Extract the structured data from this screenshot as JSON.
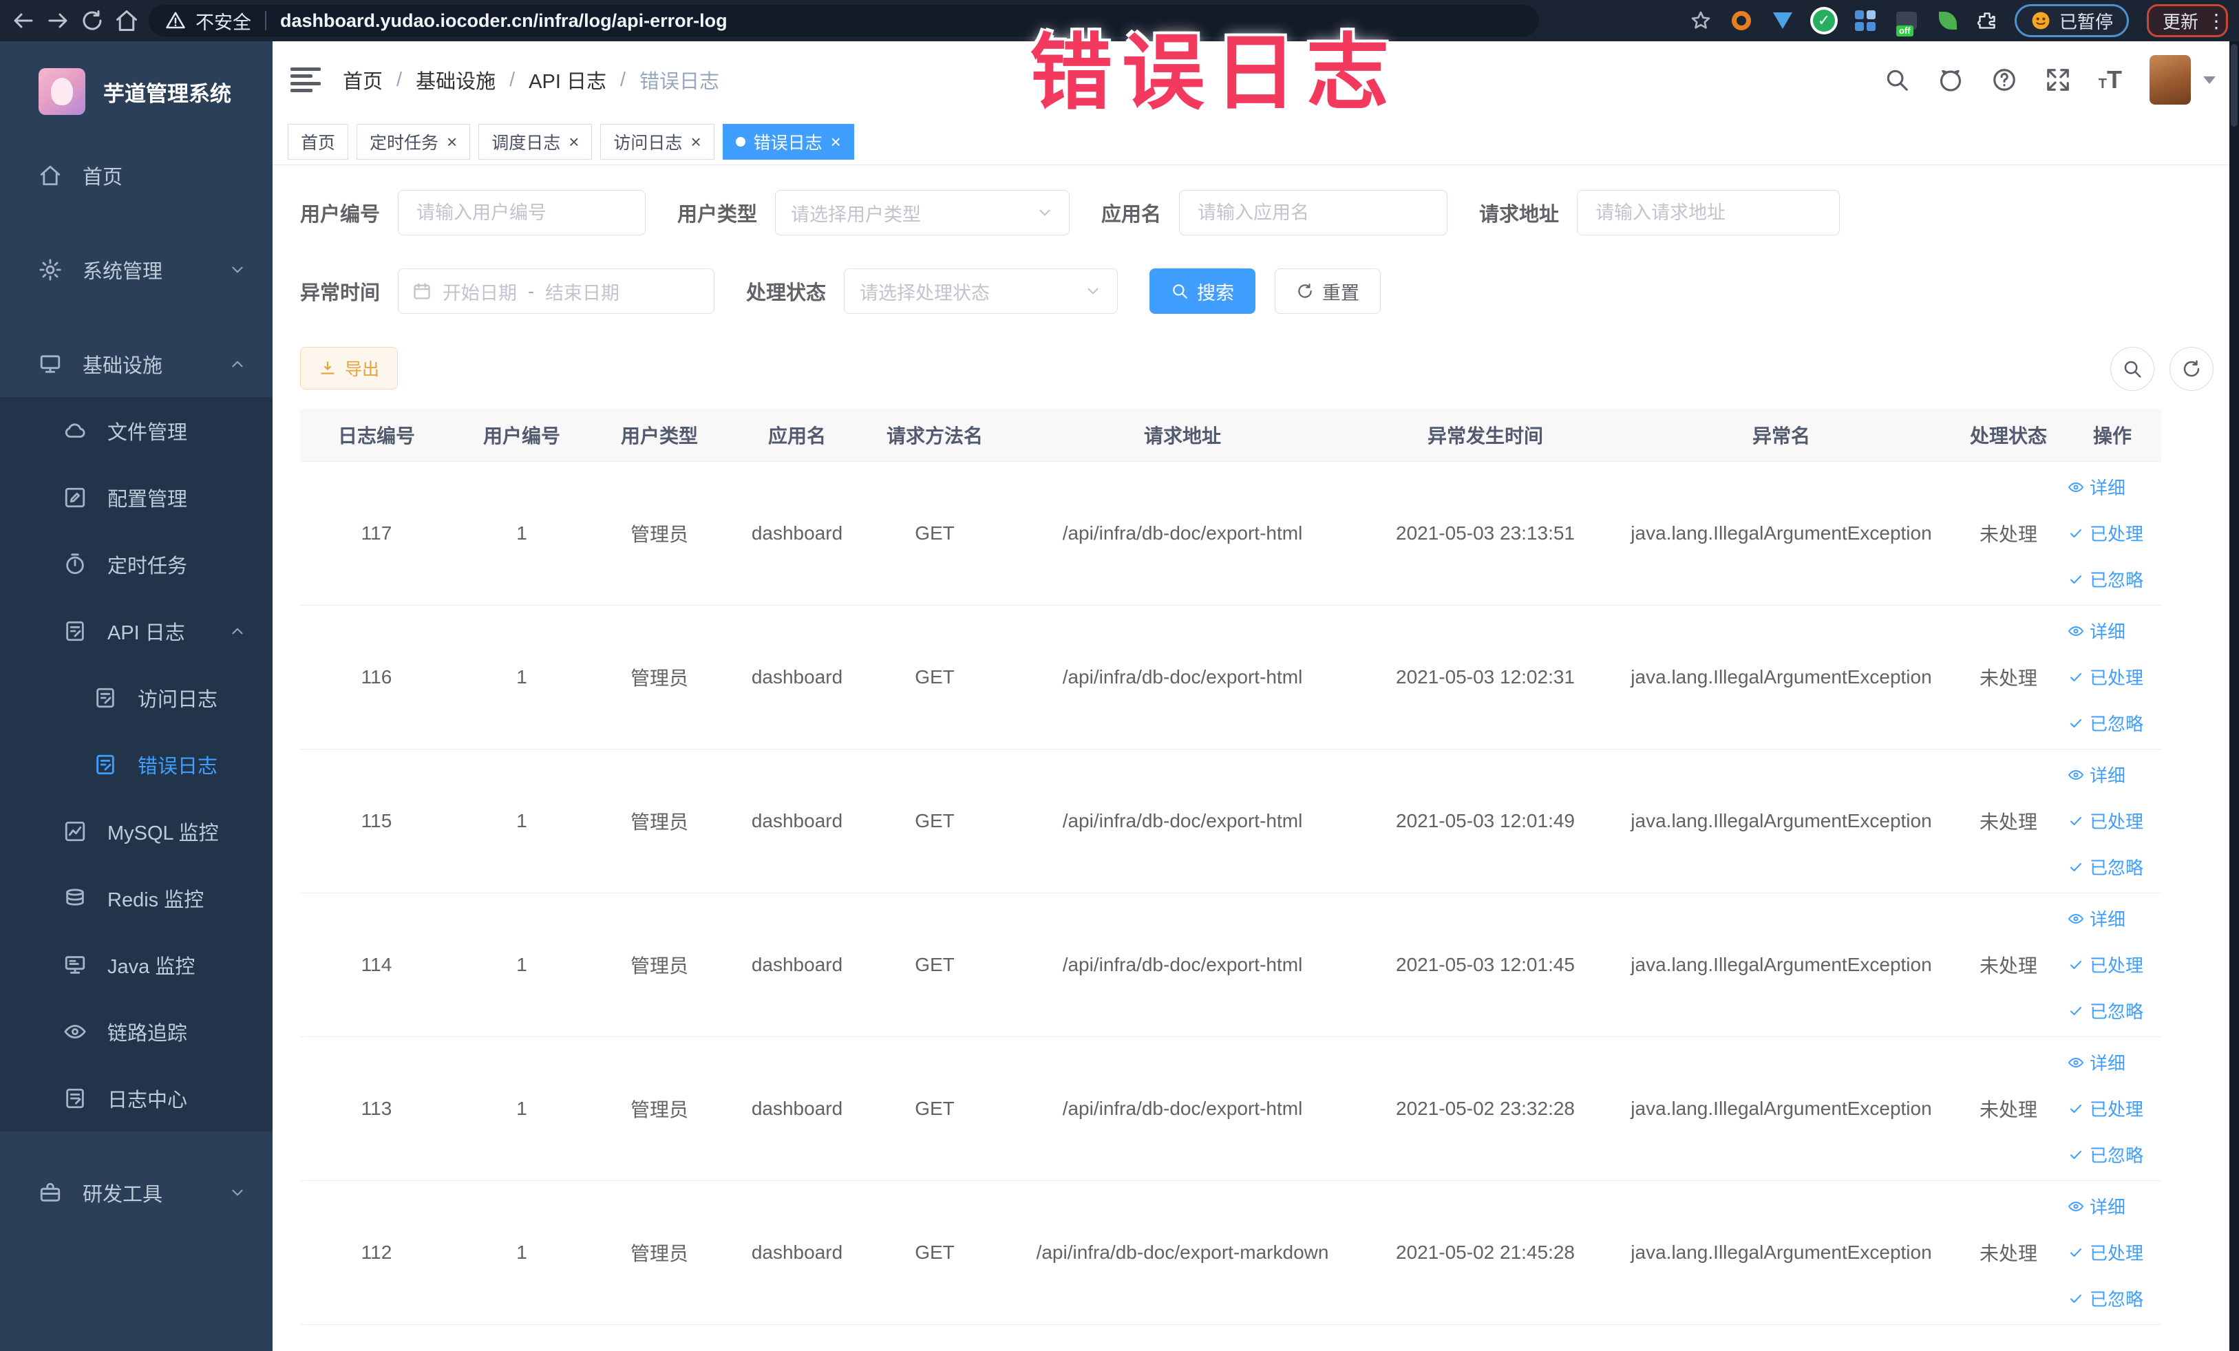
{
  "overlay_title": "错误日志",
  "browser": {
    "security_label": "不安全",
    "url": "dashboard.yudao.iocoder.cn/infra/log/api-error-log",
    "paused_badge": "已暂停",
    "update_badge": "更新"
  },
  "sidebar": {
    "logo_title": "芋道管理系统",
    "items": [
      {
        "label": "首页",
        "icon": "home",
        "depth": 0,
        "chevron": null,
        "active": false,
        "sub": false
      },
      {
        "label": "系统管理",
        "icon": "gear",
        "depth": 0,
        "chevron": "down",
        "active": false,
        "sub": false,
        "gap": true
      },
      {
        "label": "基础设施",
        "icon": "monitor",
        "depth": 0,
        "chevron": "up",
        "active": false,
        "sub": false,
        "gap": true
      },
      {
        "label": "文件管理",
        "icon": "cloud",
        "depth": 1,
        "chevron": null,
        "active": false,
        "sub": true
      },
      {
        "label": "配置管理",
        "icon": "edit",
        "depth": 1,
        "chevron": null,
        "active": false,
        "sub": true
      },
      {
        "label": "定时任务",
        "icon": "timer",
        "depth": 1,
        "chevron": null,
        "active": false,
        "sub": true
      },
      {
        "label": "API 日志",
        "icon": "apilog",
        "depth": 1,
        "chevron": "up",
        "active": false,
        "sub": true
      },
      {
        "label": "访问日志",
        "icon": "apilog",
        "depth": 2,
        "chevron": null,
        "active": false,
        "sub": true
      },
      {
        "label": "错误日志",
        "icon": "apilog",
        "depth": 2,
        "chevron": null,
        "active": true,
        "sub": true
      },
      {
        "label": "MySQL 监控",
        "icon": "mysql",
        "depth": 1,
        "chevron": null,
        "active": false,
        "sub": true
      },
      {
        "label": "Redis 监控",
        "icon": "redis",
        "depth": 1,
        "chevron": null,
        "active": false,
        "sub": true
      },
      {
        "label": "Java 监控",
        "icon": "java",
        "depth": 1,
        "chevron": null,
        "active": false,
        "sub": true
      },
      {
        "label": "链路追踪",
        "icon": "trace",
        "depth": 1,
        "chevron": null,
        "active": false,
        "sub": true
      },
      {
        "label": "日志中心",
        "icon": "logcenter",
        "depth": 1,
        "chevron": null,
        "active": false,
        "sub": true
      },
      {
        "label": "研发工具",
        "icon": "tools",
        "depth": 0,
        "chevron": "down",
        "active": false,
        "sub": false,
        "gap": true
      }
    ]
  },
  "header": {
    "breadcrumb": [
      "首页",
      "基础设施",
      "API 日志",
      "错误日志"
    ]
  },
  "tabs": [
    {
      "label": "首页",
      "closable": false,
      "active": false
    },
    {
      "label": "定时任务",
      "closable": true,
      "active": false
    },
    {
      "label": "调度日志",
      "closable": true,
      "active": false
    },
    {
      "label": "访问日志",
      "closable": true,
      "active": false
    },
    {
      "label": "错误日志",
      "closable": true,
      "active": true
    }
  ],
  "filters": {
    "user_id": {
      "label": "用户编号",
      "placeholder": "请输入用户编号"
    },
    "user_type": {
      "label": "用户类型",
      "placeholder": "请选择用户类型"
    },
    "app_name": {
      "label": "应用名",
      "placeholder": "请输入应用名"
    },
    "request_url": {
      "label": "请求地址",
      "placeholder": "请输入请求地址"
    },
    "exception_time": {
      "label": "异常时间",
      "start_placeholder": "开始日期",
      "separator": "-",
      "end_placeholder": "结束日期"
    },
    "process_status": {
      "label": "处理状态",
      "placeholder": "请选择处理状态"
    },
    "search_label": "搜索",
    "reset_label": "重置"
  },
  "toolbar": {
    "export_label": "导出"
  },
  "table": {
    "columns": [
      "日志编号",
      "用户编号",
      "用户类型",
      "应用名",
      "请求方法名",
      "请求地址",
      "异常发生时间",
      "异常名",
      "处理状态",
      "操作"
    ],
    "rows": [
      {
        "cells": [
          "117",
          "1",
          "管理员",
          "dashboard",
          "GET",
          "/api/infra/db-doc/export-html",
          "2021-05-03 23:13:51",
          "java.lang.IllegalArgumentException",
          "未处理"
        ]
      },
      {
        "cells": [
          "116",
          "1",
          "管理员",
          "dashboard",
          "GET",
          "/api/infra/db-doc/export-html",
          "2021-05-03 12:02:31",
          "java.lang.IllegalArgumentException",
          "未处理"
        ]
      },
      {
        "cells": [
          "115",
          "1",
          "管理员",
          "dashboard",
          "GET",
          "/api/infra/db-doc/export-html",
          "2021-05-03 12:01:49",
          "java.lang.IllegalArgumentException",
          "未处理"
        ]
      },
      {
        "cells": [
          "114",
          "1",
          "管理员",
          "dashboard",
          "GET",
          "/api/infra/db-doc/export-html",
          "2021-05-03 12:01:45",
          "java.lang.IllegalArgumentException",
          "未处理"
        ]
      },
      {
        "cells": [
          "113",
          "1",
          "管理员",
          "dashboard",
          "GET",
          "/api/infra/db-doc/export-html",
          "2021-05-02 23:32:28",
          "java.lang.IllegalArgumentException",
          "未处理"
        ]
      },
      {
        "cells": [
          "112",
          "1",
          "管理员",
          "dashboard",
          "GET",
          "/api/infra/db-doc/export-markdown",
          "2021-05-02 21:45:28",
          "java.lang.IllegalArgumentException",
          "未处理"
        ]
      }
    ],
    "row_actions": [
      {
        "label": "详细",
        "icon": "eye"
      },
      {
        "label": "已处理",
        "icon": "check"
      },
      {
        "label": "已忽略",
        "icon": "check"
      }
    ]
  },
  "colors": {
    "accent": "#409eff",
    "warning": "#e6a23c",
    "overlay_red": "#f4395f",
    "sidebar_bg": "#2b4058",
    "submenu_bg": "#22344a"
  }
}
